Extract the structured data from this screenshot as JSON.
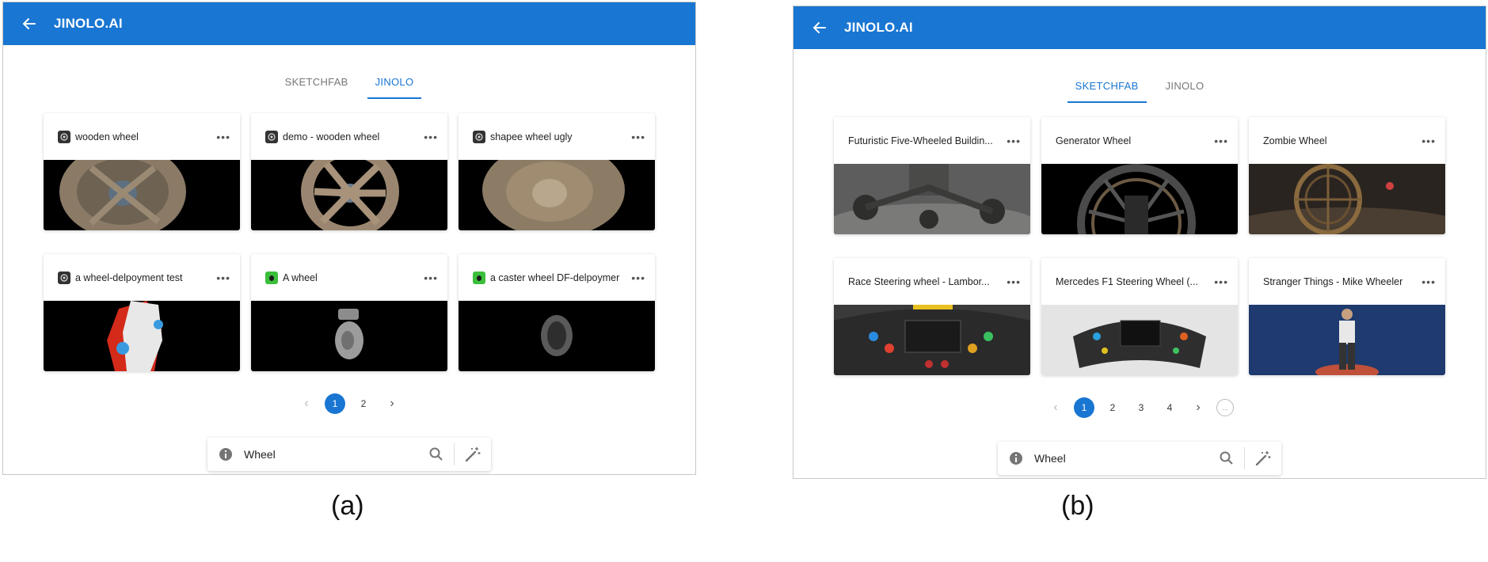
{
  "panels": {
    "a": {
      "app_title": "JINOLO.AI",
      "tabs": [
        {
          "label": "SKETCHFAB",
          "active": false
        },
        {
          "label": "JINOLO",
          "active": true
        }
      ],
      "cards": [
        {
          "title": "wooden wheel",
          "icon": "model-avatar-icon"
        },
        {
          "title": "demo - wooden wheel",
          "icon": "model-avatar-icon"
        },
        {
          "title": "shapee wheel ugly",
          "icon": "model-avatar-icon"
        },
        {
          "title": "a wheel-delpoyment test",
          "icon": "model-avatar-icon"
        },
        {
          "title": "A wheel",
          "icon": "bug-avatar-icon"
        },
        {
          "title": "a caster wheel DF-delpoymer",
          "icon": "bug-avatar-icon"
        }
      ],
      "pagination": {
        "prev": "‹",
        "pages": [
          "1",
          "2"
        ],
        "next": "›"
      },
      "search": {
        "value": "Wheel"
      }
    },
    "b": {
      "app_title": "JINOLO.AI",
      "tabs": [
        {
          "label": "SKETCHFAB",
          "active": true
        },
        {
          "label": "JINOLO",
          "active": false
        }
      ],
      "cards": [
        {
          "title": "Futuristic Five-Wheeled Buildin..."
        },
        {
          "title": "Generator Wheel"
        },
        {
          "title": "Zombie Wheel"
        },
        {
          "title": "Race Steering wheel - Lambor..."
        },
        {
          "title": "Mercedes F1 Steering Wheel (..."
        },
        {
          "title": "Stranger Things - Mike Wheeler"
        }
      ],
      "pagination": {
        "prev": "‹",
        "pages": [
          "1",
          "2",
          "3",
          "4"
        ],
        "next": "›",
        "more": "..."
      },
      "search": {
        "value": "Wheel"
      }
    }
  },
  "captions": {
    "a": "(a)",
    "b": "(b)"
  },
  "colors": {
    "primary": "#1976d2",
    "media_bg": "#000000"
  }
}
